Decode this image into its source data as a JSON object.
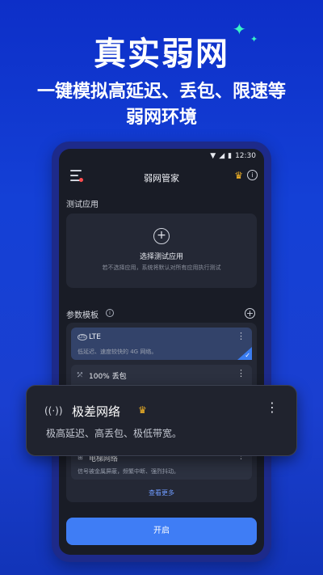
{
  "hero": {
    "title": "真实弱网",
    "subtitle_line1": "一键模拟高延迟、丢包、限速等",
    "subtitle_line2": "弱网环境"
  },
  "status_bar": {
    "time": "12:30"
  },
  "app_bar": {
    "title": "弱网管家"
  },
  "test_app": {
    "section_label": "测试应用",
    "add_symbol": "+",
    "select_label": "选择测试应用",
    "select_desc": "若不选择应用，系统将默认对所有应用执行测试"
  },
  "param_templates": {
    "section_label": "参数模板",
    "items": [
      {
        "icon": "LTE",
        "name": "LTE",
        "desc": "低延迟、速度较快的 4G 网络。",
        "selected": true
      },
      {
        "icon": "⤱",
        "name": "100% 丢包",
        "desc": "",
        "selected": false
      },
      {
        "icon": "⊞",
        "name": "电梯网络",
        "desc": "信号被金属屏蔽，频繁中断、强烈抖动。",
        "selected": false
      }
    ],
    "see_more": "查看更多"
  },
  "popup": {
    "icon": "((·))",
    "title": "极差网络",
    "desc": "极高延迟、高丢包、极低带宽。"
  },
  "start_button": "开启",
  "colors": {
    "accent": "#3f7df5",
    "crown": "#f7b626",
    "sparkle": "#39f5c6"
  }
}
